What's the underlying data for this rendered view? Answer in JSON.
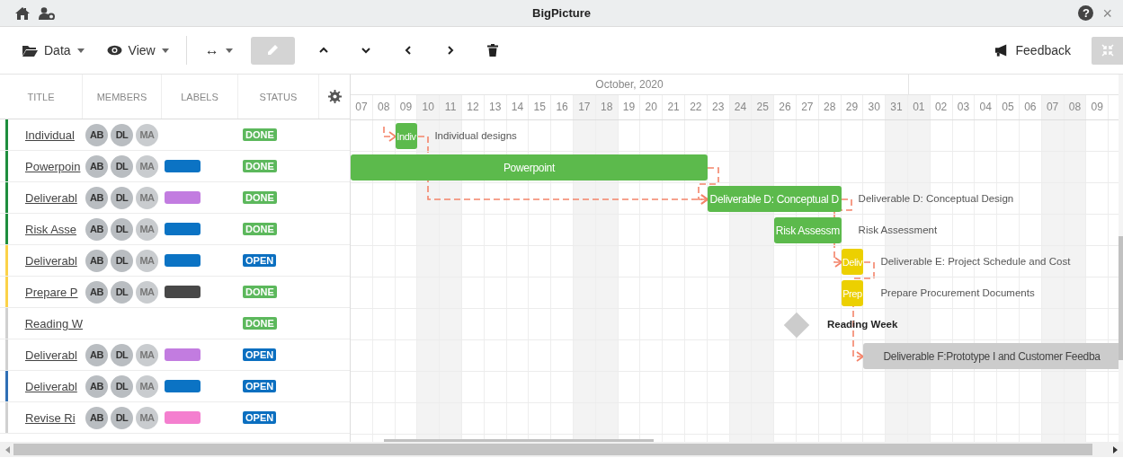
{
  "window": {
    "title": "BigPicture",
    "help": "?",
    "close": "×"
  },
  "toolbar": {
    "menus": [
      {
        "label": "Data",
        "kind": "folder"
      },
      {
        "label": "View",
        "kind": "eye"
      }
    ],
    "arrange": "↔",
    "feedback": "Feedback"
  },
  "table": {
    "columns": [
      "TITLE",
      "MEMBERS",
      "LABELS",
      "STATUS"
    ],
    "rows": [
      {
        "title": "Individual",
        "color": "#1e8e3e",
        "members": [
          "AB",
          "DL",
          "MA"
        ],
        "status": {
          "text": "DONE",
          "color": "#5cb85c"
        }
      },
      {
        "title": "Powerpoin",
        "color": "#1e8e3e",
        "members": [
          "AB",
          "DL",
          "MA"
        ],
        "label": {
          "color": "#0b73c4"
        },
        "status": {
          "text": "DONE",
          "color": "#5cb85c"
        }
      },
      {
        "title": "Deliverabl",
        "color": "#1e8e3e",
        "members": [
          "AB",
          "DL",
          "MA"
        ],
        "label": {
          "color": "#c27ce0"
        },
        "status": {
          "text": "DONE",
          "color": "#5cb85c"
        }
      },
      {
        "title": "Risk Asse",
        "color": "#1e8e3e",
        "members": [
          "AB",
          "DL",
          "MA"
        ],
        "label": {
          "color": "#0b73c4"
        },
        "status": {
          "text": "DONE",
          "color": "#5cb85c"
        }
      },
      {
        "title": "Deliverabl",
        "color": "#fbd249",
        "members": [
          "AB",
          "DL",
          "MA"
        ],
        "label": {
          "color": "#0b73c4"
        },
        "status": {
          "text": "OPEN",
          "color": "#0b6fc0"
        }
      },
      {
        "title": "Prepare P",
        "color": "#fbd249",
        "members": [
          "AB",
          "DL",
          "MA"
        ],
        "label": {
          "color": "#484848"
        },
        "status": {
          "text": "DONE",
          "color": "#5cb85c"
        }
      },
      {
        "title": "Reading W",
        "color": "#d0d0d0",
        "members": [],
        "status": {
          "text": "DONE",
          "color": "#5cb85c"
        }
      },
      {
        "title": "Deliverabl",
        "color": "#d0d0d0",
        "members": [
          "AB",
          "DL",
          "MA"
        ],
        "label": {
          "color": "#c27ce0"
        },
        "status": {
          "text": "OPEN",
          "color": "#0b6fc0"
        }
      },
      {
        "title": "Deliverabl",
        "color": "#2f6fb5",
        "members": [
          "AB",
          "DL",
          "MA"
        ],
        "label": {
          "color": "#0b73c4"
        },
        "status": {
          "text": "OPEN",
          "color": "#0b6fc0"
        }
      },
      {
        "title": "Revise Ri",
        "color": "#d0d0d0",
        "members": [
          "AB",
          "DL",
          "MA"
        ],
        "label": {
          "color": "#f47fcf"
        },
        "status": {
          "text": "OPEN",
          "color": "#0b6fc0"
        }
      }
    ]
  },
  "gantt": {
    "month": "October, 2020",
    "days": [
      {
        "label": "07",
        "weekend": false
      },
      {
        "label": "08",
        "weekend": false
      },
      {
        "label": "09",
        "weekend": false
      },
      {
        "label": "10",
        "weekend": true
      },
      {
        "label": "11",
        "weekend": true
      },
      {
        "label": "12",
        "weekend": false
      },
      {
        "label": "13",
        "weekend": false
      },
      {
        "label": "14",
        "weekend": false
      },
      {
        "label": "15",
        "weekend": false
      },
      {
        "label": "16",
        "weekend": false
      },
      {
        "label": "17",
        "weekend": true
      },
      {
        "label": "18",
        "weekend": true
      },
      {
        "label": "19",
        "weekend": false
      },
      {
        "label": "20",
        "weekend": false
      },
      {
        "label": "21",
        "weekend": false
      },
      {
        "label": "22",
        "weekend": false
      },
      {
        "label": "23",
        "weekend": false
      },
      {
        "label": "24",
        "weekend": true
      },
      {
        "label": "25",
        "weekend": true
      },
      {
        "label": "26",
        "weekend": false
      },
      {
        "label": "27",
        "weekend": false
      },
      {
        "label": "28",
        "weekend": false
      },
      {
        "label": "29",
        "weekend": false
      },
      {
        "label": "30",
        "weekend": false
      },
      {
        "label": "31",
        "weekend": true
      },
      {
        "label": "01",
        "weekend": true
      },
      {
        "label": "02",
        "weekend": false
      },
      {
        "label": "03",
        "weekend": false
      },
      {
        "label": "04",
        "weekend": false
      },
      {
        "label": "05",
        "weekend": false
      },
      {
        "label": "06",
        "weekend": false
      },
      {
        "label": "07",
        "weekend": true
      },
      {
        "label": "08",
        "weekend": true
      },
      {
        "label": "09",
        "weekend": false
      }
    ],
    "bars": [
      {
        "kind": "task",
        "text": "Indiv",
        "color": "#5cba4c",
        "side_label": "Individual designs"
      },
      {
        "kind": "task",
        "text": "Powerpoint",
        "color": "#5cba4c"
      },
      {
        "kind": "task",
        "text": "Deliverable D: Conceptual D",
        "color": "#5cba4c",
        "side_label": "Deliverable D: Conceptual Design"
      },
      {
        "kind": "task",
        "text": "Risk Assessm",
        "color": "#5cba4c",
        "side_label": "Risk Assessment"
      },
      {
        "kind": "task",
        "text": "Deliv",
        "color": "#ecd000",
        "side_label": "Deliverable E: Project Schedule and Cost"
      },
      {
        "kind": "task",
        "text": "Prep",
        "color": "#ecd000",
        "side_label": "Prepare Procurement Documents"
      },
      {
        "kind": "milestone",
        "color": "#cccccc",
        "side_label": "Reading Week"
      },
      {
        "kind": "task",
        "text": "Deliverable F:Prototype I and Customer Feedba",
        "color": "#cccccc"
      }
    ]
  }
}
